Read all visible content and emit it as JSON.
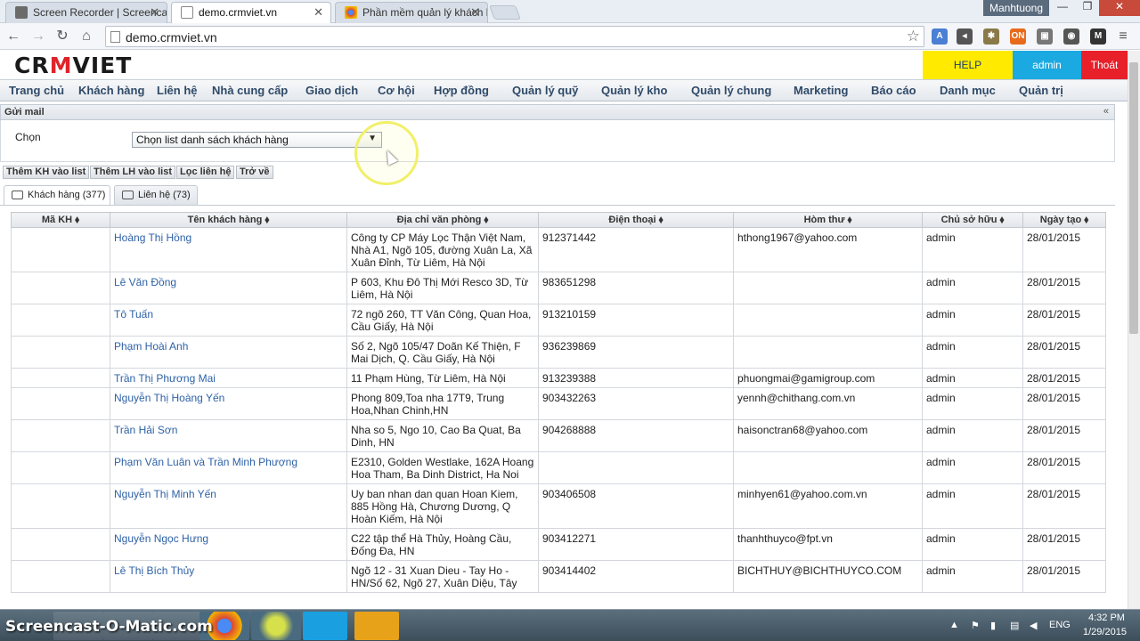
{
  "browser": {
    "tabs": [
      {
        "label": "Screen Recorder | Screencast-O-Matic",
        "icon": "screencast-icon"
      },
      {
        "label": "demo.crmviet.vn",
        "icon": "page-icon"
      },
      {
        "label": "Phần mềm quản lý khách hàng",
        "icon": "chrome-icon"
      }
    ],
    "user": "Manhtuong",
    "url": "demo.crmviet.vn"
  },
  "app": {
    "logo_left": "CR",
    "logo_o": "M",
    "logo_right": "VIET",
    "help": "HELP",
    "admin": "admin",
    "logout": "Thoát"
  },
  "menu": [
    "Trang chủ",
    "Khách hàng",
    "Liên hệ",
    "Nhà cung cấp",
    "Giao dịch",
    "Cơ hội",
    "Hợp đồng",
    "Quản lý quỹ",
    "Quản lý kho",
    "Quản lý chung",
    "Marketing",
    "Báo cáo",
    "Danh mục",
    "Quản trị"
  ],
  "panel": {
    "title": "Gửi mail",
    "collapse": "«",
    "choose_label": "Chọn",
    "select_value": "Chọn list danh sách khách hàng"
  },
  "actions": [
    "Thêm KH vào list",
    "Thêm LH vào list",
    "Lọc liên hệ",
    "Trở về"
  ],
  "subtabs": [
    "Khách hàng (377)",
    "Liên hệ (73)"
  ],
  "table": {
    "headers": [
      "Mã KH ⬧",
      "Tên khách hàng ⬧",
      "Địa chỉ văn phòng ⬧",
      "Điện thoại ⬧",
      "Hòm thư ⬧",
      "Chủ sở hữu ⬧",
      "Ngày tạo ⬧"
    ],
    "rows": [
      [
        "",
        "Hoàng Thị Hồng",
        "Công ty CP Máy Lọc Thận Việt Nam, Nhà A1, Ngõ 105, đường Xuân La, Xã Xuân Đỉnh, Từ Liêm, Hà Nội",
        "912371442",
        "hthong1967@yahoo.com",
        "admin",
        "28/01/2015"
      ],
      [
        "",
        "Lê Văn Đồng",
        "P 603, Khu Đô Thị Mới Resco 3D, Từ Liêm, Hà Nội",
        "983651298",
        "",
        "admin",
        "28/01/2015"
      ],
      [
        "",
        "Tô Tuấn",
        "72 ngõ 260, TT Văn Công, Quan Hoa, Cầu Giấy, Hà Nội",
        "913210159",
        "",
        "admin",
        "28/01/2015"
      ],
      [
        "",
        "Phạm Hoài Anh",
        "Số 2, Ngõ 105/47 Doãn Kế Thiện, F Mai Dịch, Q. Cầu Giấy, Hà Nội",
        "936239869",
        "",
        "admin",
        "28/01/2015"
      ],
      [
        "",
        "Trần Thị Phương Mai",
        "11 Phạm Hùng, Từ Liêm, Hà Nội",
        "913239388",
        "phuongmai@gamigroup.com",
        "admin",
        "28/01/2015"
      ],
      [
        "",
        "Nguyễn Thị Hoàng Yến",
        "Phong 809,Toa nha 17T9, Trung Hoa,Nhan Chinh,HN",
        "903432263",
        "yennh@chithang.com.vn",
        "admin",
        "28/01/2015"
      ],
      [
        "",
        "Trần Hải Sơn",
        "Nha so 5, Ngo 10, Cao Ba Quat, Ba Dinh, HN",
        "904268888",
        "haisonctran68@yahoo.com",
        "admin",
        "28/01/2015"
      ],
      [
        "",
        "Phạm Văn Luân và Trần Minh Phượng",
        "E2310, Golden Westlake, 162A Hoang Hoa Tham, Ba Dinh District, Ha Noi",
        "",
        "",
        "admin",
        "28/01/2015"
      ],
      [
        "",
        "Nguyễn Thị Minh Yến",
        "Uy ban nhan dan quan Hoan Kiem, 885 Hồng Hà, Chương Dương, Q Hoàn Kiếm, Hà Nội",
        "903406508",
        "minhyen61@yahoo.com.vn",
        "admin",
        "28/01/2015"
      ],
      [
        "",
        "Nguyễn Ngọc Hưng",
        "C22 tập thể Hà Thủy, Hoàng Cầu, Đống Đa, HN",
        "903412271",
        "thanhthuyco@fpt.vn",
        "admin",
        "28/01/2015"
      ],
      [
        "",
        "Lê Thị Bích Thủy",
        "Ngõ 12 - 31 Xuan Dieu - Tay Ho - HN/Số 62, Ngõ 27, Xuân Diệu, Tây",
        "903414402",
        "BICHTHUY@BICHTHUYCO.COM",
        "admin",
        "28/01/2015"
      ]
    ]
  },
  "taskbar": {
    "watermark": "Screencast-O-Matic.com",
    "lang": "ENG",
    "time": "4:32 PM",
    "date": "1/29/2015"
  },
  "colors": {
    "help": "#ffea00",
    "admin": "#1ba9e1",
    "logout": "#e8202a",
    "link": "#2e62a6"
  }
}
